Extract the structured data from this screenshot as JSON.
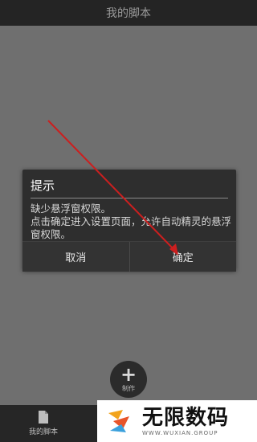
{
  "header": {
    "title": "我的脚本"
  },
  "dialog": {
    "title": "提示",
    "message": "缺少悬浮窗权限。\n点击确定进入设置页面，允许自动精灵的悬浮窗权限。",
    "cancel_label": "取消",
    "confirm_label": "确定"
  },
  "fab": {
    "icon": "plus-icon",
    "label": "制作"
  },
  "bottom_nav": {
    "items": [
      {
        "label": "我的脚本",
        "icon": "file-icon"
      }
    ]
  },
  "watermark": {
    "text": "无限数码",
    "subtext": "WWW.WUXIAN.GROUP"
  },
  "colors": {
    "annotation_arrow": "#cc1f1f",
    "dialog_bg": "#2e2e2e",
    "overlay": "#6f6f6f"
  }
}
